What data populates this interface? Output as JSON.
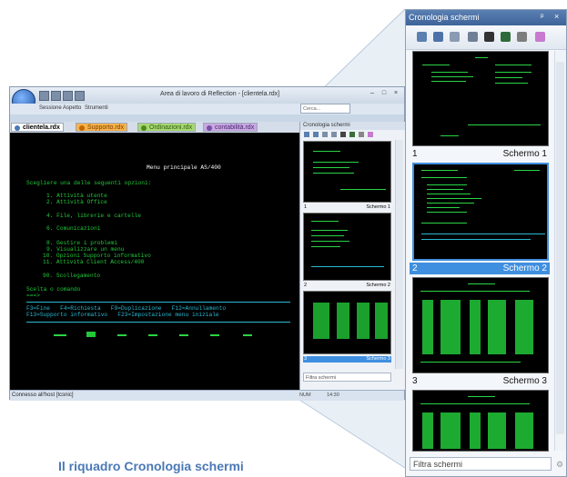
{
  "caption": "Il riquadro Cronologia schermi",
  "window": {
    "title": "Area di lavoro di Reflection - [clientela.rdx]",
    "menu": [
      "Sessione",
      "Aspetto",
      "Strumenti"
    ],
    "tabs": [
      "clientela.rdx",
      "Supporto.rdx",
      "Ordinazioni.rdx",
      "contabilità.rdx"
    ],
    "find_placeholder": "Cerca...",
    "status": {
      "left": "Connesso all'host [tcsnic]",
      "segments": [
        "NUM",
        "14:30"
      ]
    }
  },
  "terminal": {
    "lines": [
      {
        "text": "Menu principale AS/400",
        "color": "white"
      },
      {
        "text": "Scegliere una delle seguenti opzioni:",
        "color": "green"
      },
      {
        "text": "1. Attività utente",
        "color": "green"
      },
      {
        "text": "2. Attività Office",
        "color": "green"
      },
      {
        "text": "4. File, librerie e cartelle",
        "color": "green"
      },
      {
        "text": "6. Comunicazioni",
        "color": "green"
      },
      {
        "text": "8. Gestire i problemi",
        "color": "green"
      },
      {
        "text": "9. Visualizzare un menu",
        "color": "green"
      },
      {
        "text": "10. Opzioni Supporto informativo",
        "color": "green"
      },
      {
        "text": "11. Attività Client Access/400",
        "color": "green"
      },
      {
        "text": "90. Scollegamento",
        "color": "green"
      },
      {
        "text": "Scelta o comando",
        "color": "green"
      },
      {
        "text": "===>",
        "color": "green"
      },
      {
        "text": "F3=Fine   F4=Richiesta   F9=Duplicazione   F12=Annullamento",
        "color": "cyan"
      },
      {
        "text": "F13=Supporto informativo   F23=Impostazione menu iniziale",
        "color": "cyan"
      }
    ]
  },
  "panel": {
    "title": "Cronologia schermi",
    "pin": "ᵖ",
    "close": "×",
    "tools": [
      "back-screen-icon",
      "save-icon",
      "copy-icon",
      "print-icon",
      "camera-icon",
      "settings-icon",
      "filter-icon",
      "eraser-icon"
    ],
    "items": [
      {
        "num": "1",
        "name": "Schermo 1",
        "selected": false
      },
      {
        "num": "2",
        "name": "Schermo 2",
        "selected": true
      },
      {
        "num": "3",
        "name": "Schermo 3",
        "selected": false
      }
    ],
    "filter_placeholder": "Filtra schermi"
  },
  "small_panel": {
    "title": "Cronologia schermi",
    "items": [
      {
        "num": "1",
        "name": "Schermo 1"
      },
      {
        "num": "2",
        "name": "Schermo 2"
      },
      {
        "num": "3",
        "name": "Schermo 3"
      }
    ],
    "filter_placeholder": "Filtra schermi"
  },
  "colors": {
    "selection": "#3f8fe0",
    "terminal_green": "#22c83a",
    "caption": "#4a78b5"
  }
}
